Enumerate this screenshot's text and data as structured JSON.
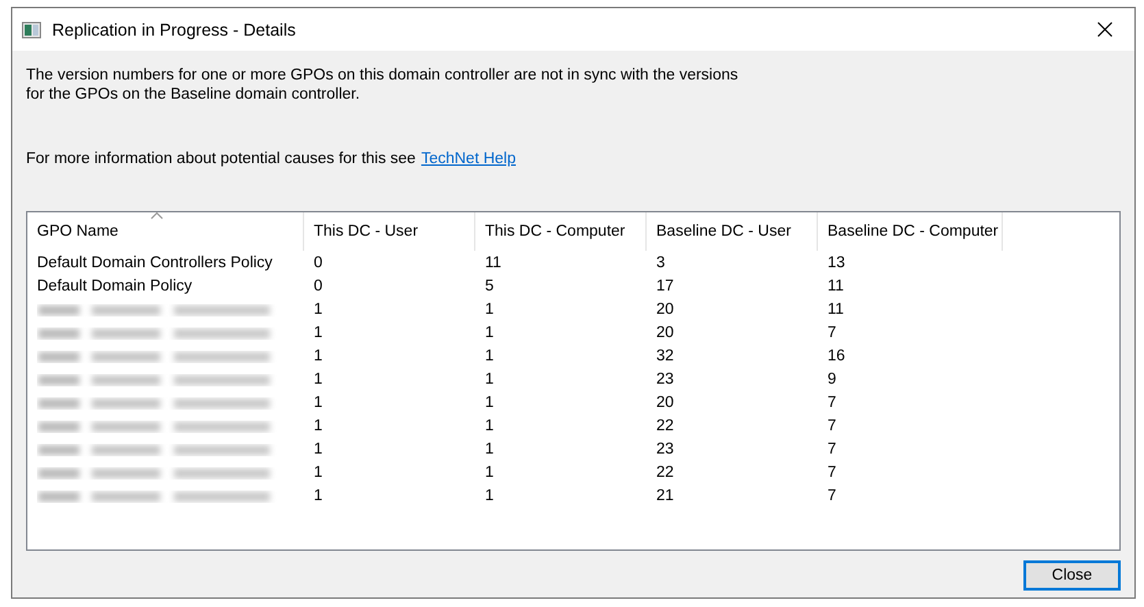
{
  "window": {
    "title": "Replication in Progress - Details"
  },
  "message": "The version numbers for one or more GPOs on this domain controller are not in sync with the versions for the GPOs on the Baseline domain controller.",
  "help": {
    "text": "For more information about potential causes for this see",
    "link": "TechNet Help"
  },
  "table": {
    "columns": [
      {
        "label": "GPO Name",
        "sorted": true
      },
      {
        "label": "This DC - User",
        "sorted": false
      },
      {
        "label": "This DC - Computer",
        "sorted": false
      },
      {
        "label": "Baseline DC - User",
        "sorted": false
      },
      {
        "label": "Baseline DC - Computer",
        "sorted": false
      }
    ],
    "rows": [
      {
        "redacted": false,
        "cells": [
          "Default Domain Controllers Policy",
          "0",
          "11",
          "3",
          "13"
        ]
      },
      {
        "redacted": false,
        "cells": [
          "Default Domain Policy",
          "0",
          "5",
          "17",
          "11"
        ]
      },
      {
        "redacted": true,
        "cells": [
          "",
          "1",
          "1",
          "20",
          "11"
        ]
      },
      {
        "redacted": true,
        "cells": [
          "",
          "1",
          "1",
          "20",
          "7"
        ]
      },
      {
        "redacted": true,
        "cells": [
          "",
          "1",
          "1",
          "32",
          "16"
        ]
      },
      {
        "redacted": true,
        "cells": [
          "",
          "1",
          "1",
          "23",
          "9"
        ]
      },
      {
        "redacted": true,
        "cells": [
          "",
          "1",
          "1",
          "20",
          "7"
        ]
      },
      {
        "redacted": true,
        "cells": [
          "",
          "1",
          "1",
          "22",
          "7"
        ]
      },
      {
        "redacted": true,
        "cells": [
          "",
          "1",
          "1",
          "23",
          "7"
        ]
      },
      {
        "redacted": true,
        "cells": [
          "",
          "1",
          "1",
          "22",
          "7"
        ]
      },
      {
        "redacted": true,
        "cells": [
          "",
          "1",
          "1",
          "21",
          "7"
        ]
      }
    ]
  },
  "buttons": [
    {
      "label": "Close",
      "default": true
    }
  ]
}
